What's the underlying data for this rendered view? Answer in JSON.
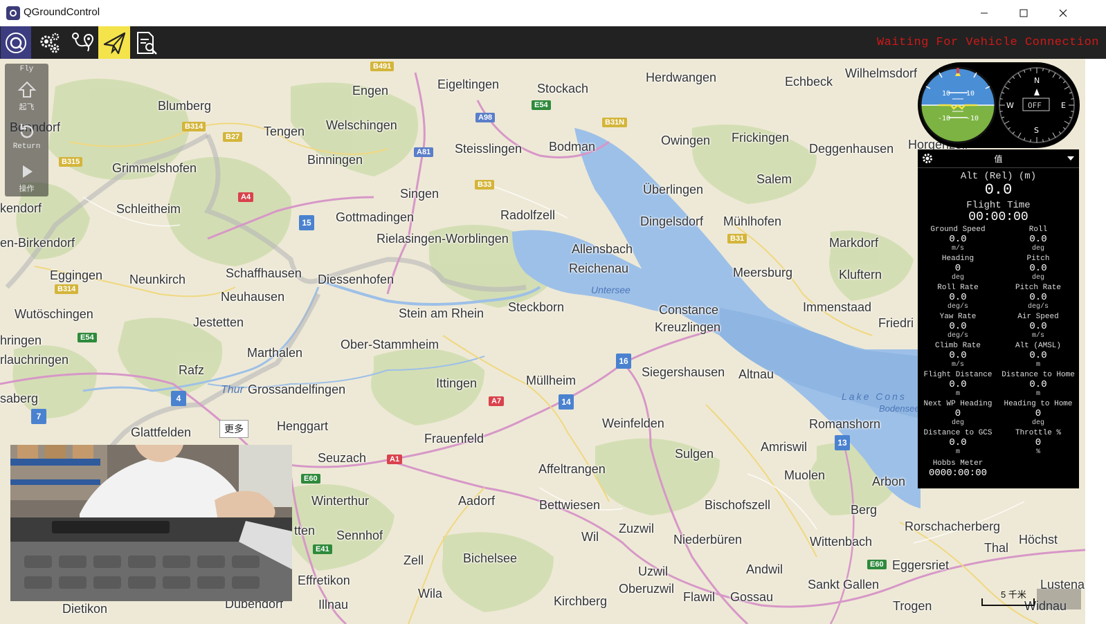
{
  "window": {
    "title": "QGroundControl"
  },
  "toolbar": {
    "status": "Waiting For Vehicle Connection",
    "buttons": [
      "app-menu",
      "vehicle-setup",
      "plan",
      "fly",
      "analyze"
    ]
  },
  "fly_panel": {
    "header": "Fly",
    "takeoff_label": "起飞",
    "return_label": "Return",
    "action_label": "操作"
  },
  "map": {
    "more_label": "更多",
    "scale_label": "5 千米",
    "places": [
      "Engen",
      "Eigeltingen",
      "Stockach",
      "Herdwangen",
      "Echbeck",
      "Wilhelmsdorf",
      "Blumberg",
      "Tengen",
      "Welschingen",
      "Steisslingen",
      "Bodman",
      "Owingen",
      "Frickingen",
      "Deggenhausen",
      "Horgenzell",
      "Bonndorf",
      "Binningen",
      "Grimmelshofen",
      "Singen",
      "Überlingen",
      "Salem",
      "kendorf",
      "Schleitheim",
      "Gottmadingen",
      "Radolfzell",
      "Dingelsdorf",
      "Mühlhofen",
      "Markdorf",
      "en-Birkendorf",
      "Rielasingen-Worblingen",
      "Allensbach",
      "Reichenau",
      "Meersburg",
      "Kluftern",
      "Eggingen",
      "Neunkirch",
      "Schaffhausen",
      "Diessenhofen",
      "Untersee",
      "Neuhausen",
      "Wutöschingen",
      "Jestetten",
      "Stein am Rhein",
      "Steckborn",
      "Constance",
      "Kreuzlingen",
      "Immenstaad",
      "Friedri",
      "hringen",
      "Ober-Stammheim",
      "rlauchringen",
      "Marthalen",
      "Rafz",
      "Siegershausen",
      "Altnau",
      "Thur",
      "Grossandelfingen",
      "Ittingen",
      "Müllheim",
      "saberg",
      "Lake Cons",
      "Bodensee",
      "Glattfelden",
      "Henggart",
      "Weinfelden",
      "Romanshorn",
      "Frauenfeld",
      "Sulgen",
      "Amriswil",
      "Seuzach",
      "Affeltrangen",
      "Muolen",
      "Arbon",
      "Winterthur",
      "Aadorf",
      "Bettwiesen",
      "Bischofszell",
      "Berg",
      "Rorschacherberg",
      "Höchst",
      "Sennhof",
      "Zuzwil",
      "Wil",
      "Niederbüren",
      "Wittenbach",
      "Thal",
      "Zell",
      "Bichelsee",
      "Uzwil",
      "Andwil",
      "Eggersriet",
      "Effretikon",
      "Oberuzwil",
      "Flawil",
      "Gossau",
      "Sankt Gallen",
      "Lustena",
      "Illnau",
      "Wila",
      "Kirchberg",
      "Trogen",
      "Widnau",
      "Dietikon",
      "Dübendorf",
      "tten"
    ],
    "roads": [
      "B491",
      "E54",
      "A98",
      "B31N",
      "B314",
      "B27",
      "A81",
      "B315",
      "B33",
      "A4",
      "15",
      "B31",
      "B314",
      "E54",
      "16",
      "4",
      "7",
      "A7",
      "14",
      "13",
      "A1",
      "E60",
      "E41",
      "E60"
    ]
  },
  "instruments": {
    "attitude_ticks": [
      "10",
      "10",
      "-10",
      "-10"
    ],
    "compass": {
      "n": "N",
      "e": "E",
      "s": "S",
      "w": "W",
      "readout": "OFF"
    }
  },
  "values_panel": {
    "header": "值",
    "alt_label": "Alt (Rel) (m)",
    "alt_value": "0.0",
    "flight_time_label": "Flight Time",
    "flight_time_value": "00:00:00",
    "cells": [
      {
        "name": "Ground Speed",
        "value": "0.0",
        "unit": "m/s"
      },
      {
        "name": "Roll",
        "value": "0.0",
        "unit": "deg"
      },
      {
        "name": "Heading",
        "value": "0",
        "unit": "deg"
      },
      {
        "name": "Pitch",
        "value": "0.0",
        "unit": "deg"
      },
      {
        "name": "Roll Rate",
        "value": "0.0",
        "unit": "deg/s"
      },
      {
        "name": "Pitch Rate",
        "value": "0.0",
        "unit": "deg/s"
      },
      {
        "name": "Yaw Rate",
        "value": "0.0",
        "unit": "deg/s"
      },
      {
        "name": "Air Speed",
        "value": "0.0",
        "unit": "m/s"
      },
      {
        "name": "Climb Rate",
        "value": "0.0",
        "unit": "m/s"
      },
      {
        "name": "Alt (AMSL)",
        "value": "0.0",
        "unit": "m"
      },
      {
        "name": "Flight Distance",
        "value": "0.0",
        "unit": "m"
      },
      {
        "name": "Distance to Home",
        "value": "0.0",
        "unit": "m"
      },
      {
        "name": "Next WP Heading",
        "value": "0",
        "unit": "deg"
      },
      {
        "name": "Heading to Home",
        "value": "0",
        "unit": "deg"
      },
      {
        "name": "Distance to GCS",
        "value": "0.0",
        "unit": "m"
      },
      {
        "name": "Throttle %",
        "value": "0",
        "unit": "%"
      }
    ],
    "hobbs_label": "Hobbs Meter",
    "hobbs_value": "0000:00:00"
  },
  "colors": {
    "toolbar_bg": "#222222",
    "active_tab": "#f4e34a",
    "status": "#d01818",
    "lake": "#9dc0e8",
    "sky": "#4a8ed6",
    "ground": "#7cb342"
  }
}
